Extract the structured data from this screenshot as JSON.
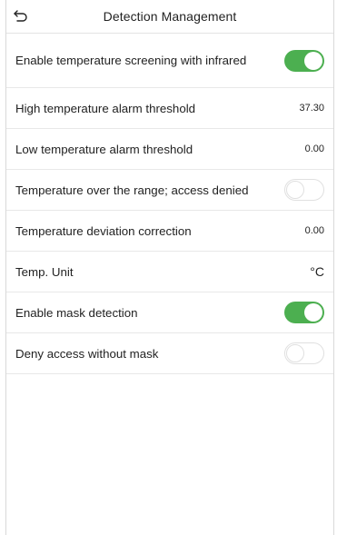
{
  "header": {
    "title": "Detection Management",
    "back_icon": "back-arrow-icon"
  },
  "settings": [
    {
      "label": "Enable temperature screening with infrared",
      "type": "toggle",
      "on": true
    },
    {
      "label": "High temperature alarm threshold",
      "type": "value",
      "value": "37.30"
    },
    {
      "label": "Low temperature alarm threshold",
      "type": "value",
      "value": "0.00"
    },
    {
      "label": "Temperature over the range; access denied",
      "type": "toggle",
      "on": false
    },
    {
      "label": "Temperature deviation correction",
      "type": "value",
      "value": "0.00"
    },
    {
      "label": "Temp. Unit",
      "type": "value",
      "value": "°C"
    },
    {
      "label": "Enable mask detection",
      "type": "toggle",
      "on": true
    },
    {
      "label": "Deny access without mask",
      "type": "toggle",
      "on": false
    }
  ],
  "colors": {
    "toggle_on": "#4caf50",
    "toggle_off": "#ffffff"
  }
}
